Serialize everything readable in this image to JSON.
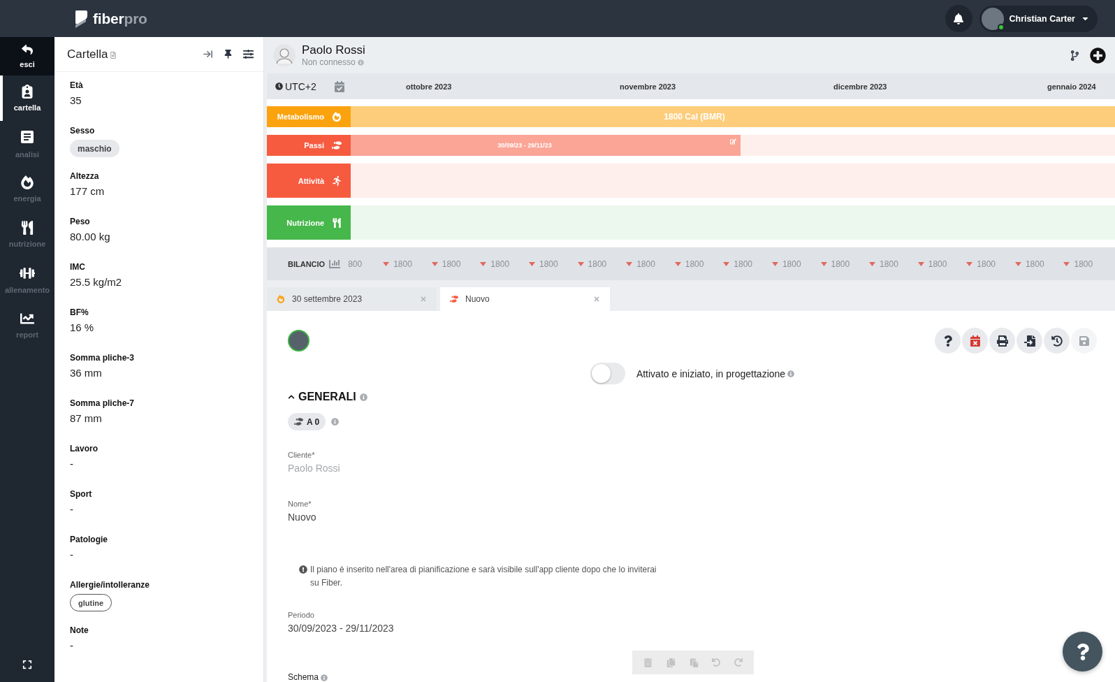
{
  "topbar": {
    "logo": {
      "name": "fiber",
      "suffix": "pro"
    },
    "user": {
      "name": "Christian Carter",
      "online": true
    }
  },
  "nav": {
    "items": [
      {
        "label": "esci",
        "kind": "exit",
        "selected": false
      },
      {
        "label": "cartella",
        "kind": "record",
        "selected": true
      },
      {
        "label": "analisi",
        "kind": "analysis",
        "selected": false
      },
      {
        "label": "energia",
        "kind": "energy",
        "selected": false
      },
      {
        "label": "nutrizione",
        "kind": "nutrition",
        "selected": false
      },
      {
        "label": "allenamento",
        "kind": "training",
        "selected": false
      },
      {
        "label": "report",
        "kind": "report",
        "selected": false
      }
    ]
  },
  "record": {
    "title": "Cartella",
    "fields": [
      {
        "label": "Età",
        "value": "35",
        "kind": "text"
      },
      {
        "label": "Sesso",
        "value": "maschio",
        "kind": "chip"
      },
      {
        "label": "Altezza",
        "value": "177 cm",
        "kind": "text"
      },
      {
        "label": "Peso",
        "value": "80.00 kg",
        "kind": "text"
      },
      {
        "label": "IMC",
        "value": "25.5 kg/m2",
        "kind": "text"
      },
      {
        "label": "BF%",
        "value": "16 %",
        "kind": "text"
      },
      {
        "label": "Somma pliche-3",
        "value": "36 mm",
        "kind": "text"
      },
      {
        "label": "Somma pliche-7",
        "value": "87 mm",
        "kind": "text"
      },
      {
        "label": "Lavoro",
        "value": "-",
        "kind": "text"
      },
      {
        "label": "Sport",
        "value": "-",
        "kind": "text"
      },
      {
        "label": "Patologie",
        "value": "-",
        "kind": "text"
      },
      {
        "label": "Allergie/intolleranze",
        "value": "glutine",
        "kind": "tag"
      },
      {
        "label": "Note",
        "value": "-",
        "kind": "text"
      }
    ]
  },
  "client": {
    "name": "Paolo Rossi",
    "status": "Non connesso"
  },
  "timeline": {
    "timezone": "UTC+2",
    "months": [
      "ottobre 2023",
      "novembre 2023",
      "dicembre 2023",
      "gennaio 2024"
    ],
    "rows": [
      {
        "label": "Metabolismo",
        "kind": "metabolism",
        "color": "#fba30f",
        "bar": {
          "text": "1800 Cal (BMR)",
          "level": 1
        }
      },
      {
        "label": "Passi",
        "kind": "steps",
        "color": "#f65b40",
        "bar": {
          "text": "30/09/23 - 29/11/23",
          "level": 0.51,
          "editable": true
        }
      },
      {
        "label": "Attività",
        "kind": "activity",
        "color": "#f65b40"
      },
      {
        "label": "Nutrizione",
        "kind": "nutrition",
        "color": "#46b74b"
      }
    ]
  },
  "balance": {
    "label": "BILANCIO",
    "values": [
      {
        "text": "800",
        "kind": "plain"
      },
      {
        "text": "1800",
        "kind": "down"
      },
      {
        "text": "1800",
        "kind": "down"
      },
      {
        "text": "1800",
        "kind": "down"
      },
      {
        "text": "1800",
        "kind": "down"
      },
      {
        "text": "1800",
        "kind": "down"
      },
      {
        "text": "1800",
        "kind": "down"
      },
      {
        "text": "1800",
        "kind": "down"
      },
      {
        "text": "1800",
        "kind": "down"
      },
      {
        "text": "1800",
        "kind": "down"
      },
      {
        "text": "1800",
        "kind": "down"
      },
      {
        "text": "1800",
        "kind": "down"
      },
      {
        "text": "1800",
        "kind": "down"
      },
      {
        "text": "1800",
        "kind": "down"
      },
      {
        "text": "1800",
        "kind": "down"
      },
      {
        "text": "1800",
        "kind": "down"
      }
    ]
  },
  "tabs": [
    {
      "label": "30 settembre 2023",
      "kind": "metabolism",
      "selected": false
    },
    {
      "label": "Nuovo",
      "kind": "steps",
      "selected": true
    }
  ],
  "plan": {
    "actions": [
      {
        "kind": "help",
        "disabled": false
      },
      {
        "kind": "unschedule",
        "disabled": false
      },
      {
        "kind": "print",
        "disabled": false
      },
      {
        "kind": "import",
        "disabled": false
      },
      {
        "kind": "history",
        "disabled": false
      },
      {
        "kind": "save",
        "disabled": true
      }
    ],
    "toggle": {
      "label": "Attivato e iniziato, in progettazione",
      "on": false
    },
    "section": {
      "title": "GENERALI",
      "expanded": true
    },
    "badge": "A 0",
    "fields": [
      {
        "label": "Cliente*",
        "value": "Paolo Rossi",
        "disabled": true
      },
      {
        "label": "Nome*",
        "value": "Nuovo",
        "disabled": false
      }
    ],
    "notice": "Il piano è inserito nell'area di pianificazione e sarà visibile sull'app cliente dopo che lo inviterai su Fiber.",
    "period": {
      "label": "Periodo",
      "value": "30/09/2023 - 29/11/2023"
    },
    "schema": {
      "label": "Schema"
    },
    "editor_toolbar": {
      "disabled": true
    }
  }
}
